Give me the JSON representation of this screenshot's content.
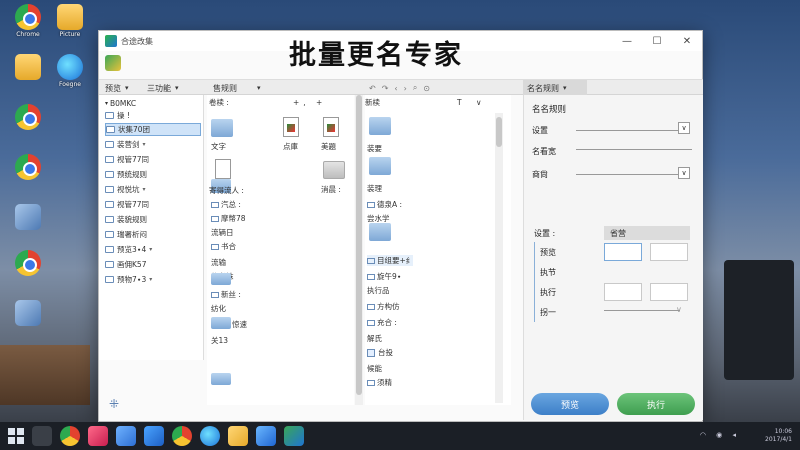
{
  "window": {
    "title": "合途改集",
    "banner": "批量更名专家",
    "controls": {
      "minimize": "—",
      "maximize": "☐",
      "close": "✕"
    }
  },
  "toolbar": {
    "back": "↶",
    "forward": "↷",
    "prev": "‹",
    "next": "›",
    "search": "⌕",
    "help": "⊙"
  },
  "pane_headers": {
    "preview": "预览",
    "functions": "三功能",
    "rules": "售规则",
    "name_rules": "名名规则"
  },
  "tree": {
    "root": "B0MKC",
    "parent": "操 !",
    "items": [
      {
        "label": "状集70团",
        "selected": true,
        "expander": ""
      },
      {
        "label": "装营剑",
        "selected": false,
        "expander": "▾"
      },
      {
        "label": "视管77同",
        "selected": false,
        "expander": ""
      },
      {
        "label": "预统规则",
        "selected": false,
        "expander": ""
      },
      {
        "label": "视悦坑",
        "selected": false,
        "expander": "▾"
      },
      {
        "label": "视管77同",
        "selected": false,
        "expander": ""
      },
      {
        "label": "装貌规则",
        "selected": false,
        "expander": ""
      },
      {
        "label": "瑞署析闷",
        "selected": false,
        "expander": ""
      },
      {
        "label": "预览3∙4",
        "selected": false,
        "expander": "▾"
      },
      {
        "label": "画佣K57",
        "selected": false,
        "expander": ""
      },
      {
        "label": "预物7∙3",
        "selected": false,
        "expander": "▾"
      }
    ]
  },
  "left_files": {
    "header": "卷椟 :",
    "tools": "+,  +",
    "icon_labels": [
      "文字",
      "点庫",
      "美題",
      "消晨 :"
    ],
    "section_label": "寄得流人 :",
    "rows": [
      "汽总 :",
      "摩幣78",
      "流辆日",
      "书合",
      "流输",
      "信煮抹",
      "新丝 :",
      "纺化",
      "惊速",
      "关13"
    ]
  },
  "right_files": {
    "header": "新椟",
    "tools": "T  ∨",
    "rows": [
      "装要",
      "装理",
      "德泉A :",
      "尝水学",
      "目组要+纟",
      "旋午9∙",
      "执行品",
      "方构仿",
      "充合 :",
      "解氏",
      "台投",
      "候能",
      "须精"
    ]
  },
  "name_panel": {
    "title": "名名规则",
    "fields": [
      {
        "label": "设置",
        "dropdown": "∨"
      },
      {
        "label": "名看宽"
      },
      {
        "label": "商尙",
        "dropdown": "∨"
      }
    ],
    "settings_label": "设置 :",
    "tab_label": "省营",
    "rows": [
      "预览",
      "执节",
      "执行",
      "拐一"
    ],
    "row_dropdown": "∨"
  },
  "actions": {
    "preview": "预览",
    "execute": "执行"
  },
  "bottom_logo": "⁜",
  "desktop_icons": [
    "Chrome",
    "Picture",
    "Foegne",
    "",
    "",
    "",
    "",
    "",
    ""
  ],
  "tray": {
    "line1": "10:06",
    "line2": "2017/4/1"
  }
}
